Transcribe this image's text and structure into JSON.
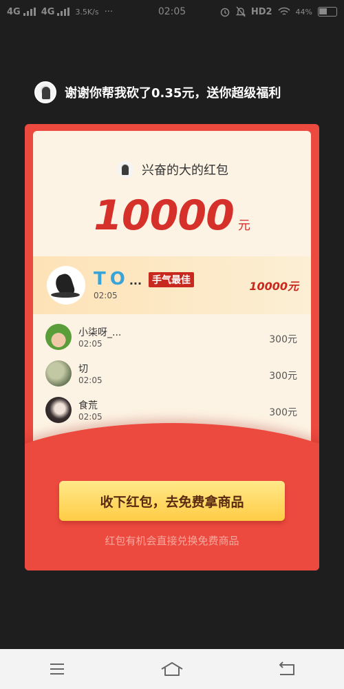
{
  "status_bar": {
    "network1": "4G",
    "network2": "4G",
    "speed": "3.5K/s",
    "more": "···",
    "time": "02:05",
    "hd": "HD2",
    "battery": "44%"
  },
  "header": {
    "message": "谢谢你帮我砍了0.35元，送你超级福利"
  },
  "envelope": {
    "sender_name": "兴奋的大的红包",
    "amount": "10000",
    "amount_unit": "元",
    "best": {
      "name": "TO",
      "ellipsis": "...",
      "badge": "手气最佳",
      "time": "02:05",
      "amount": "10000元"
    },
    "recipients": [
      {
        "name": "小柒呀_...",
        "time": "02:05",
        "amount": "300元"
      },
      {
        "name": "切",
        "time": "02:05",
        "amount": "300元"
      },
      {
        "name": "食荒",
        "time": "02:05",
        "amount": "300元"
      }
    ],
    "cta_label": "收下红包，去免费拿商品",
    "footnote": "红包有机会直接兑换免费商品"
  },
  "colors": {
    "envelope_red": "#ec4a3f",
    "amount_red": "#d6302a",
    "cta_yellow": "#ffcc45",
    "best_name_blue": "#39a4d8"
  },
  "icons": {
    "nav": [
      "menu-icon",
      "home-icon",
      "back-icon"
    ]
  }
}
